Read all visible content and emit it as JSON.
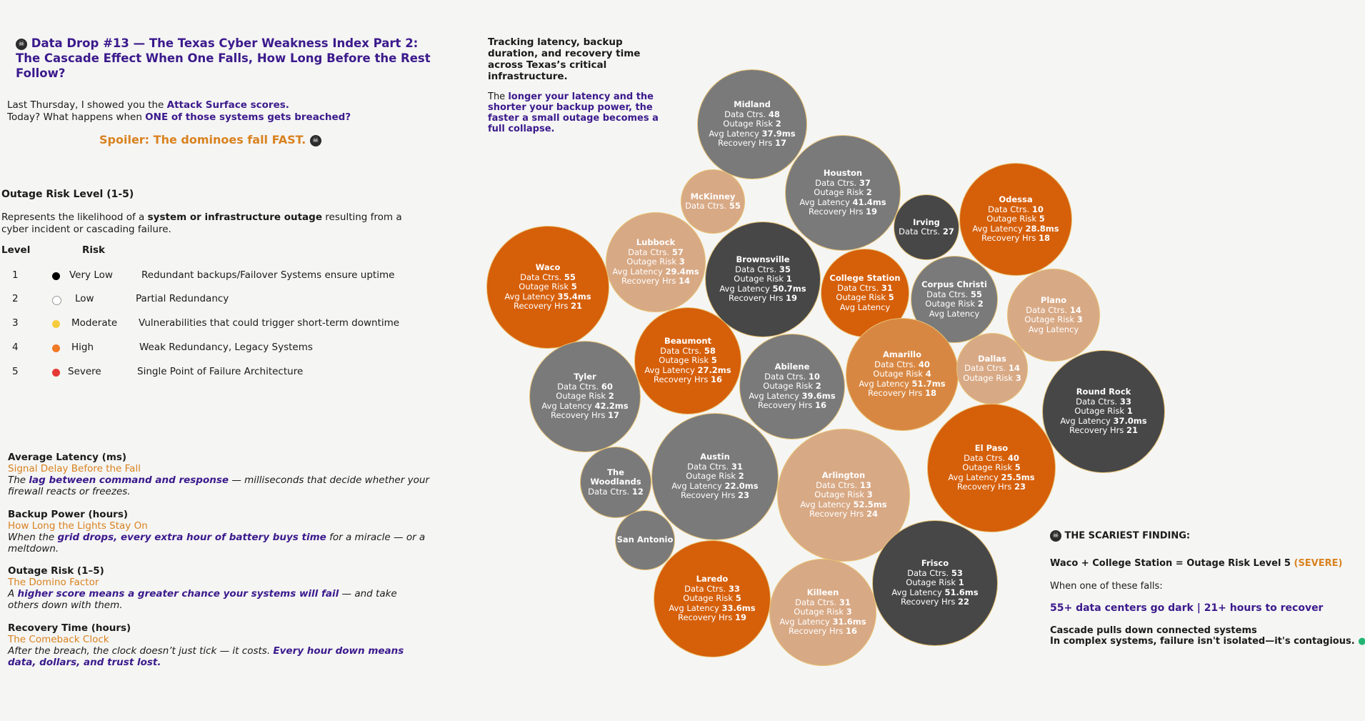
{
  "title": "Data Drop #13 — The Texas Cyber Weakness Index Part 2: The Cascade Effect When One Falls, How Long Before the Rest Follow?",
  "intro": {
    "line1_pre": "Last Thursday, I showed you the ",
    "line1_em": "Attack Surface scores.",
    "line2_pre": "Today? What happens when ",
    "line2_em": "ONE of those systems gets breached?",
    "spoiler": "Spoiler: The dominoes fall FAST."
  },
  "risk_scale": {
    "heading": "Outage Risk Level (1-5)",
    "desc_pre": "Represents the likelihood of a ",
    "desc_em": "system or infrastructure outage",
    "desc_post": " resulting from a cyber incident or cascading failure.",
    "col_level": "Level",
    "col_risk": "Risk",
    "levels": [
      {
        "level": "1",
        "label": "Very Low",
        "desc": "Redundant backups/Failover Systems ensure uptime",
        "color": "#000000"
      },
      {
        "level": "2",
        "label": "Low",
        "desc": "Partial Redundancy",
        "color": "#ffffff"
      },
      {
        "level": "3",
        "label": "Moderate",
        "desc": "Vulnerabilities that could trigger short-term downtime",
        "color": "#f5cc3d"
      },
      {
        "level": "4",
        "label": "High",
        "desc": "Weak Redundancy, Legacy Systems",
        "color": "#f07a26"
      },
      {
        "level": "5",
        "label": "Severe",
        "desc": "Single Point of Failure Architecture",
        "color": "#e53935"
      }
    ]
  },
  "metrics": [
    {
      "head": "Average Latency (ms)",
      "sub": "Signal Delay Before the Fall",
      "d_pre": "The ",
      "d_em": "lag between command and response",
      "d_post": " — milliseconds that decide whether your firewall reacts or freezes."
    },
    {
      "head": "Backup Power (hours)",
      "sub": "How Long the Lights Stay On",
      "d_pre": "When the ",
      "d_em": "grid drops, every extra hour of battery buys time",
      "d_post": " for a miracle — or a meltdown."
    },
    {
      "head": "Outage Risk (1–5)",
      "sub": "The Domino Factor",
      "d_pre": "A ",
      "d_em": "higher score means a greater chance your systems will fail",
      "d_post": " — and take others down with them."
    },
    {
      "head": "Recovery Time (hours)",
      "sub": "The Comeback Clock",
      "d_pre": "After the breach, the clock doesn’t just tick — it costs. ",
      "d_em": "Every hour down means data, dollars, and trust lost.",
      "d_post": ""
    }
  ],
  "tracking": {
    "headline": "Tracking latency, backup duration, and recovery time across Texas’s critical infrastructure.",
    "body_pre": "The ",
    "body_em": "longer your latency and the shorter your backup power, the faster a small outage becomes a full collapse."
  },
  "colors": {
    "risk1": "#474747",
    "risk2": "#7a7a7a",
    "risk3": "#d8a985",
    "risk4": "#d88742",
    "risk5": "#d65f0a",
    "accent_purple": "#3b1a8c",
    "accent_orange": "#d9821f"
  },
  "chart_data": {
    "type": "bubble",
    "labels": {
      "data_ctrs": "Data Ctrs.",
      "outage_risk": "Outage Risk",
      "avg_latency": "Avg Latency",
      "recovery_hrs": "Recovery Hrs"
    },
    "cities": [
      {
        "name": "Midland",
        "data_ctrs": "48",
        "outage_risk": "2",
        "avg_latency": "37.9ms",
        "recovery_hrs": "17"
      },
      {
        "name": "McKinney",
        "data_ctrs": "55",
        "outage_risk": null,
        "avg_latency": null,
        "recovery_hrs": null
      },
      {
        "name": "Houston",
        "data_ctrs": "37",
        "outage_risk": "2",
        "avg_latency": "41.4ms",
        "recovery_hrs": "19"
      },
      {
        "name": "Irving",
        "data_ctrs": "27",
        "outage_risk": null,
        "avg_latency": null,
        "recovery_hrs": null
      },
      {
        "name": "Odessa",
        "data_ctrs": "10",
        "outage_risk": "5",
        "avg_latency": "28.8ms",
        "recovery_hrs": "18"
      },
      {
        "name": "Lubbock",
        "data_ctrs": "57",
        "outage_risk": "3",
        "avg_latency": "29.4ms",
        "recovery_hrs": "14"
      },
      {
        "name": "Waco",
        "data_ctrs": "55",
        "outage_risk": "5",
        "avg_latency": "35.4ms",
        "recovery_hrs": "21"
      },
      {
        "name": "Brownsville",
        "data_ctrs": "35",
        "outage_risk": "1",
        "avg_latency": "50.7ms",
        "recovery_hrs": "19"
      },
      {
        "name": "College Station",
        "data_ctrs": "31",
        "outage_risk": "5",
        "avg_latency": "",
        "recovery_hrs": null
      },
      {
        "name": "Corpus Christi",
        "data_ctrs": "55",
        "outage_risk": "2",
        "avg_latency": "",
        "recovery_hrs": null
      },
      {
        "name": "Plano",
        "data_ctrs": "14",
        "outage_risk": "3",
        "avg_latency": "",
        "recovery_hrs": null
      },
      {
        "name": "Beaumont",
        "data_ctrs": "58",
        "outage_risk": "5",
        "avg_latency": "27.2ms",
        "recovery_hrs": "16"
      },
      {
        "name": "Abilene",
        "data_ctrs": "10",
        "outage_risk": "2",
        "avg_latency": "39.6ms",
        "recovery_hrs": "16"
      },
      {
        "name": "Amarillo",
        "data_ctrs": "40",
        "outage_risk": "4",
        "avg_latency": "51.7ms",
        "recovery_hrs": "18"
      },
      {
        "name": "Dallas",
        "data_ctrs": "14",
        "outage_risk": "3",
        "avg_latency": null,
        "recovery_hrs": null
      },
      {
        "name": "Tyler",
        "data_ctrs": "60",
        "outage_risk": "2",
        "avg_latency": "42.2ms",
        "recovery_hrs": "17"
      },
      {
        "name": "Round Rock",
        "data_ctrs": "33",
        "outage_risk": "1",
        "avg_latency": "37.0ms",
        "recovery_hrs": "21"
      },
      {
        "name": "The Woodlands",
        "data_ctrs": "12",
        "outage_risk": null,
        "avg_latency": null,
        "recovery_hrs": null
      },
      {
        "name": "Austin",
        "data_ctrs": "31",
        "outage_risk": "2",
        "avg_latency": "22.0ms",
        "recovery_hrs": "23"
      },
      {
        "name": "Arlington",
        "data_ctrs": "13",
        "outage_risk": "3",
        "avg_latency": "52.5ms",
        "recovery_hrs": "24"
      },
      {
        "name": "El Paso",
        "data_ctrs": "40",
        "outage_risk": "5",
        "avg_latency": "25.5ms",
        "recovery_hrs": "23"
      },
      {
        "name": "San Antonio",
        "data_ctrs": null,
        "outage_risk": null,
        "avg_latency": null,
        "recovery_hrs": null
      },
      {
        "name": "Laredo",
        "data_ctrs": "33",
        "outage_risk": "5",
        "avg_latency": "33.6ms",
        "recovery_hrs": "19"
      },
      {
        "name": "Killeen",
        "data_ctrs": "31",
        "outage_risk": "3",
        "avg_latency": "31.6ms",
        "recovery_hrs": "16"
      },
      {
        "name": "Frisco",
        "data_ctrs": "53",
        "outage_risk": "1",
        "avg_latency": "51.6ms",
        "recovery_hrs": "22"
      }
    ]
  },
  "finding": {
    "heading": "THE SCARIEST FINDING:",
    "eq_pre": "Waco + College Station = Outage Risk Level 5 ",
    "eq_em": "(SEVERE)",
    "when": "When one of these falls:",
    "impact": "55+ data centers go dark | 21+ hours to recover",
    "cascade1": "Cascade pulls down connected systems",
    "cascade2": "In complex systems, failure isn't isolated—it's contagious."
  }
}
